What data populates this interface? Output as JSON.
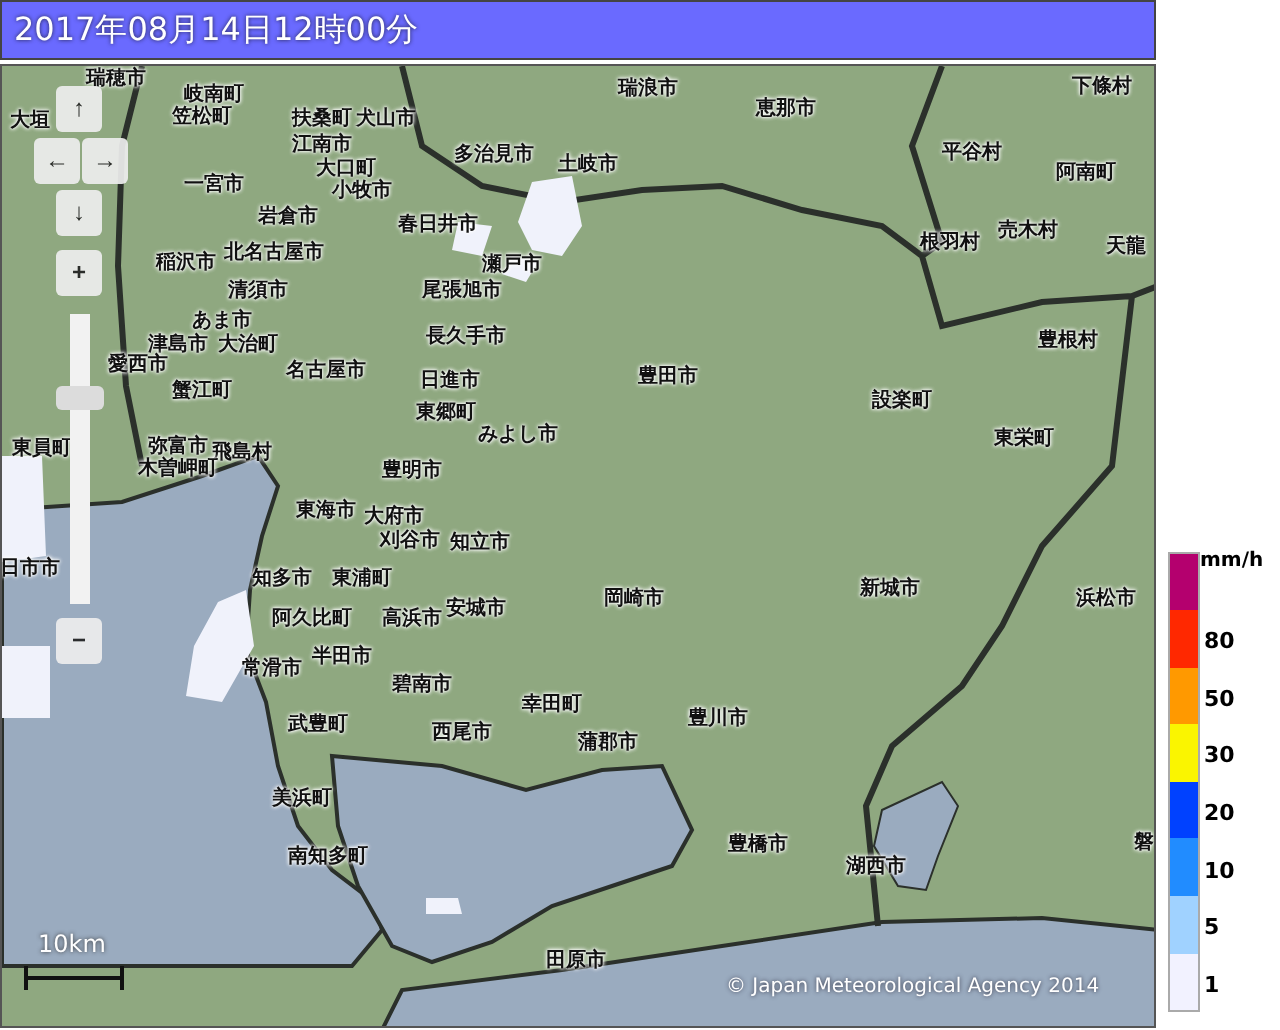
{
  "title": "2017年08月14日12時00分",
  "map": {
    "place_labels": [
      "大垣",
      "瑞穂市",
      "岐南町",
      "笠松町",
      "扶桑町",
      "犬山市",
      "江南市",
      "大口町",
      "一宮市",
      "小牧市",
      "岩倉市",
      "春日井市",
      "北名古屋市",
      "稲沢市",
      "清須市",
      "尾張旭市",
      "あま市",
      "津島市",
      "大治町",
      "愛西市",
      "名古屋市",
      "長久手市",
      "日進市",
      "蟹江町",
      "東郷町",
      "みよし市",
      "弥富市",
      "飛島村",
      "木曽岬町",
      "東員町",
      "豊明市",
      "東海市",
      "大府市",
      "刈谷市",
      "知多市",
      "東浦町",
      "阿久比町",
      "高浜市",
      "半田市",
      "常滑市",
      "碧南市",
      "武豊町",
      "美浜町",
      "南知多町",
      "知立市",
      "安城市",
      "西尾市",
      "幸田町",
      "蒲郡市",
      "岡崎市",
      "豊川市",
      "豊橋市",
      "田原市",
      "湖西市",
      "新城市",
      "浜松市",
      "豊田市",
      "多治見市",
      "瀬戸市",
      "土岐市",
      "瑞浪市",
      "恵那市",
      "下條村",
      "平谷村",
      "阿南町",
      "根羽村",
      "売木村",
      "天龍",
      "豊根村",
      "設楽町",
      "東栄町",
      "磐",
      "日市市"
    ],
    "scale": "10km",
    "copyright": "© Japan Meteorological Agency 2014"
  },
  "controls": {
    "pan_up": "↑",
    "pan_left": "←",
    "pan_right": "→",
    "pan_down": "↓",
    "zoom_in": "+",
    "zoom_out": "−",
    "zoom": {
      "level": 0.72
    }
  },
  "legend": {
    "unit": "mm/h",
    "swatches": [
      {
        "color": "#b4006e"
      },
      {
        "color": "#ff2800"
      },
      {
        "color": "#ff9900"
      },
      {
        "color": "#faf500"
      },
      {
        "color": "#0041ff"
      },
      {
        "color": "#218cff"
      },
      {
        "color": "#a0d2ff"
      },
      {
        "color": "#f2f2ff"
      }
    ],
    "labels": [
      "80",
      "50",
      "30",
      "20",
      "10",
      "5",
      "1"
    ]
  }
}
